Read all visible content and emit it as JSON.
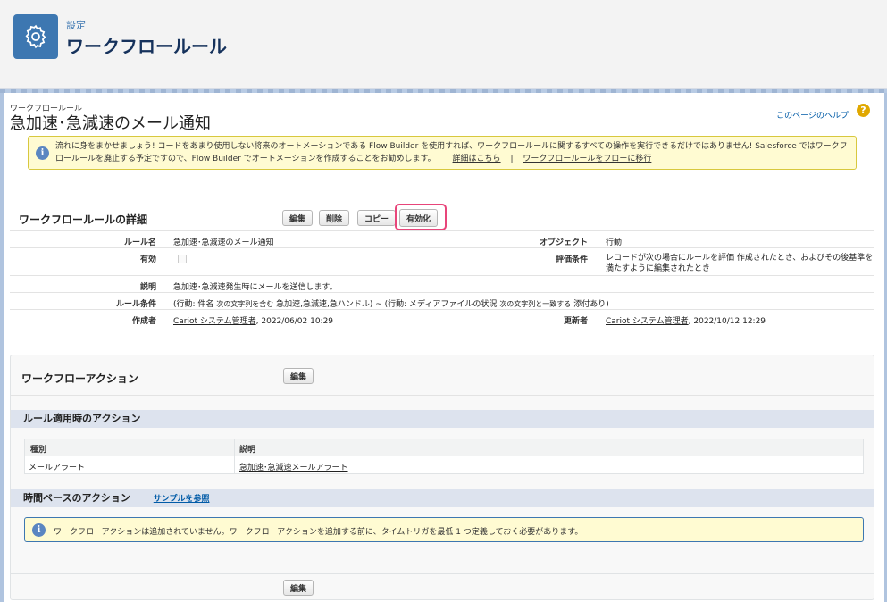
{
  "header": {
    "eyebrow": "設定",
    "title": "ワークフロールール"
  },
  "page": {
    "eyebrow": "ワークフロールール",
    "title": "急加速･急減速のメール通知",
    "help_link": "このページのヘルプ",
    "help_icon": "?"
  },
  "notice": {
    "text": "流れに身をまかせましょう! コードをあまり使用しない将来のオートメーションである Flow Builder を使用すれば、ワークフロールールに関するすべての操作を実行できるだけではありません! Salesforce ではワークフロールールを廃止する予定ですので、Flow Builder でオートメーションを作成することをお勧めします。",
    "link_details": "詳細はこちら",
    "separator": "|",
    "link_migrate": "ワークフロールールをフローに移行"
  },
  "detail": {
    "section_title": "ワークフロールールの詳細",
    "buttons": {
      "edit": "編集",
      "delete": "削除",
      "copy": "コピー",
      "activate": "有効化"
    },
    "fields": {
      "rule_name_label": "ルール名",
      "rule_name_value": "急加速･急減速のメール通知",
      "object_label": "オブジェクト",
      "object_value": "行動",
      "active_label": "有効",
      "eval_label": "評価条件",
      "eval_value": "レコードが次の場合にルールを評価 作成されたとき、およびその後基準を満たすように編集されたとき",
      "desc_label": "説明",
      "desc_value": "急加速･急減速発生時にメールを送信します。",
      "criteria_label": "ルール条件",
      "criteria_p1": "(行動: 件名",
      "criteria_p2": "次の文字列を含む",
      "criteria_p3": "急加速,急減速,急ハンドル) ~ (行動: メディアファイルの状況",
      "criteria_p4": "次の文字列と一致する",
      "criteria_p5": "添付あり)",
      "created_label": "作成者",
      "created_user": "Cariot システム管理者",
      "created_date": ", 2022/06/02 10:29",
      "modified_label": "更新者",
      "modified_user": "Cariot システム管理者",
      "modified_date": ", 2022/10/12 12:29"
    }
  },
  "workflow_actions": {
    "title": "ワークフローアクション",
    "edit_label": "編集",
    "immediate_title": "ルール適用時のアクション",
    "table": {
      "headers": [
        "種別",
        "説明"
      ],
      "rows": [
        [
          "メールアラート",
          "急加速･急減速メールアラート"
        ]
      ]
    },
    "time_based_title": "時間ベースのアクション",
    "sample_link": "サンプルを参照",
    "notice": "ワークフローアクションは追加されていません。ワークフローアクションを追加する前に、タイムトリガを最低 1 つ定義しておく必要があります。",
    "bottom_edit_label": "編集"
  },
  "colors": {
    "brand_blue": "#3d77b1",
    "link": "#015ba7",
    "highlight": "#e8457a",
    "notice_bg": "#fffbd2"
  }
}
